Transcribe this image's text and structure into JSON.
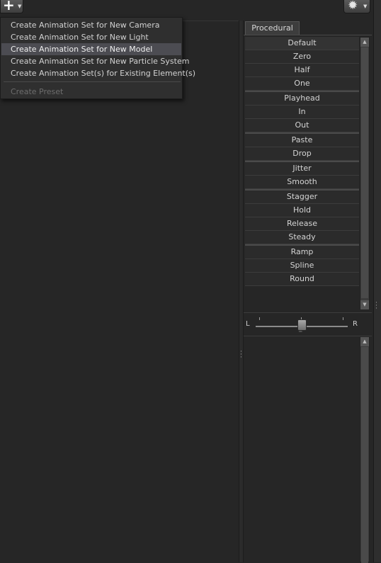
{
  "toolbar": {
    "add_icon": "plus-icon",
    "settings_icon": "gear-icon"
  },
  "tab": {
    "label": "Procedural"
  },
  "menu": {
    "items": [
      {
        "label": "Create Animation Set for New Camera",
        "state": "normal"
      },
      {
        "label": "Create Animation Set for New Light",
        "state": "normal"
      },
      {
        "label": "Create Animation Set for New Model",
        "state": "highlighted"
      },
      {
        "label": "Create Animation Set for New Particle System",
        "state": "normal"
      },
      {
        "label": "Create Animation Set(s) for Existing Element(s)",
        "state": "normal"
      }
    ],
    "preset": {
      "label": "Create Preset",
      "state": "disabled"
    }
  },
  "procedural_list": [
    "Default",
    "Zero",
    "Half",
    "One",
    "Playhead",
    "In",
    "Out",
    "Paste",
    "Drop",
    "Jitter",
    "Smooth",
    "Stagger",
    "Hold",
    "Release",
    "Steady",
    "Ramp",
    "Spline",
    "Round"
  ],
  "balance": {
    "left_label": "L",
    "right_label": "R",
    "value": 0.5
  }
}
